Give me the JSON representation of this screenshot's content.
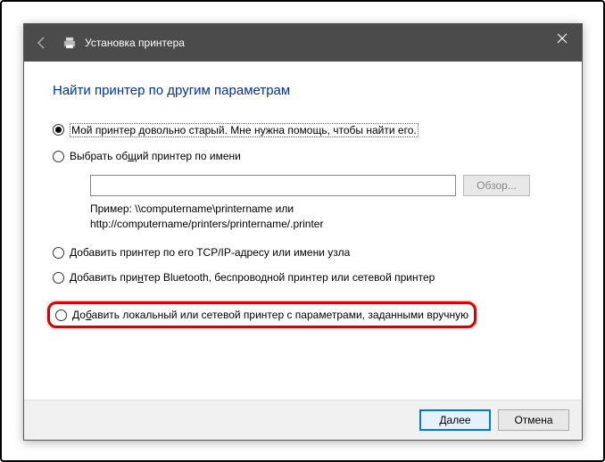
{
  "window": {
    "title": "Установка принтера"
  },
  "heading": "Найти принтер по другим параметрам",
  "options": {
    "opt1": "Мой принтер довольно старый. Мне нужна помощь, чтобы найти его.",
    "opt2_pre": "Выбрать об",
    "opt2_u": "щ",
    "opt2_post": "ий принтер по имени",
    "browse": "Обзор...",
    "example_l1": "Пример: \\\\computername\\printername или",
    "example_l2": "http://computername/printers/printername/.printer",
    "opt3": "Добавить принтер по его TCP/IP-адресу или имени узла",
    "opt4_pre": "Добавить при",
    "opt4_u": "н",
    "opt4_post": "тер Bluetooth, беспроводной принтер или сетевой принтер",
    "opt5_pre": "До",
    "opt5_u": "б",
    "opt5_post": "авить локальный или сетевой принтер с параметрами, заданными вручную"
  },
  "footer": {
    "next_pre": "",
    "next_u": "Д",
    "next_post": "алее",
    "cancel": "Отмена"
  }
}
